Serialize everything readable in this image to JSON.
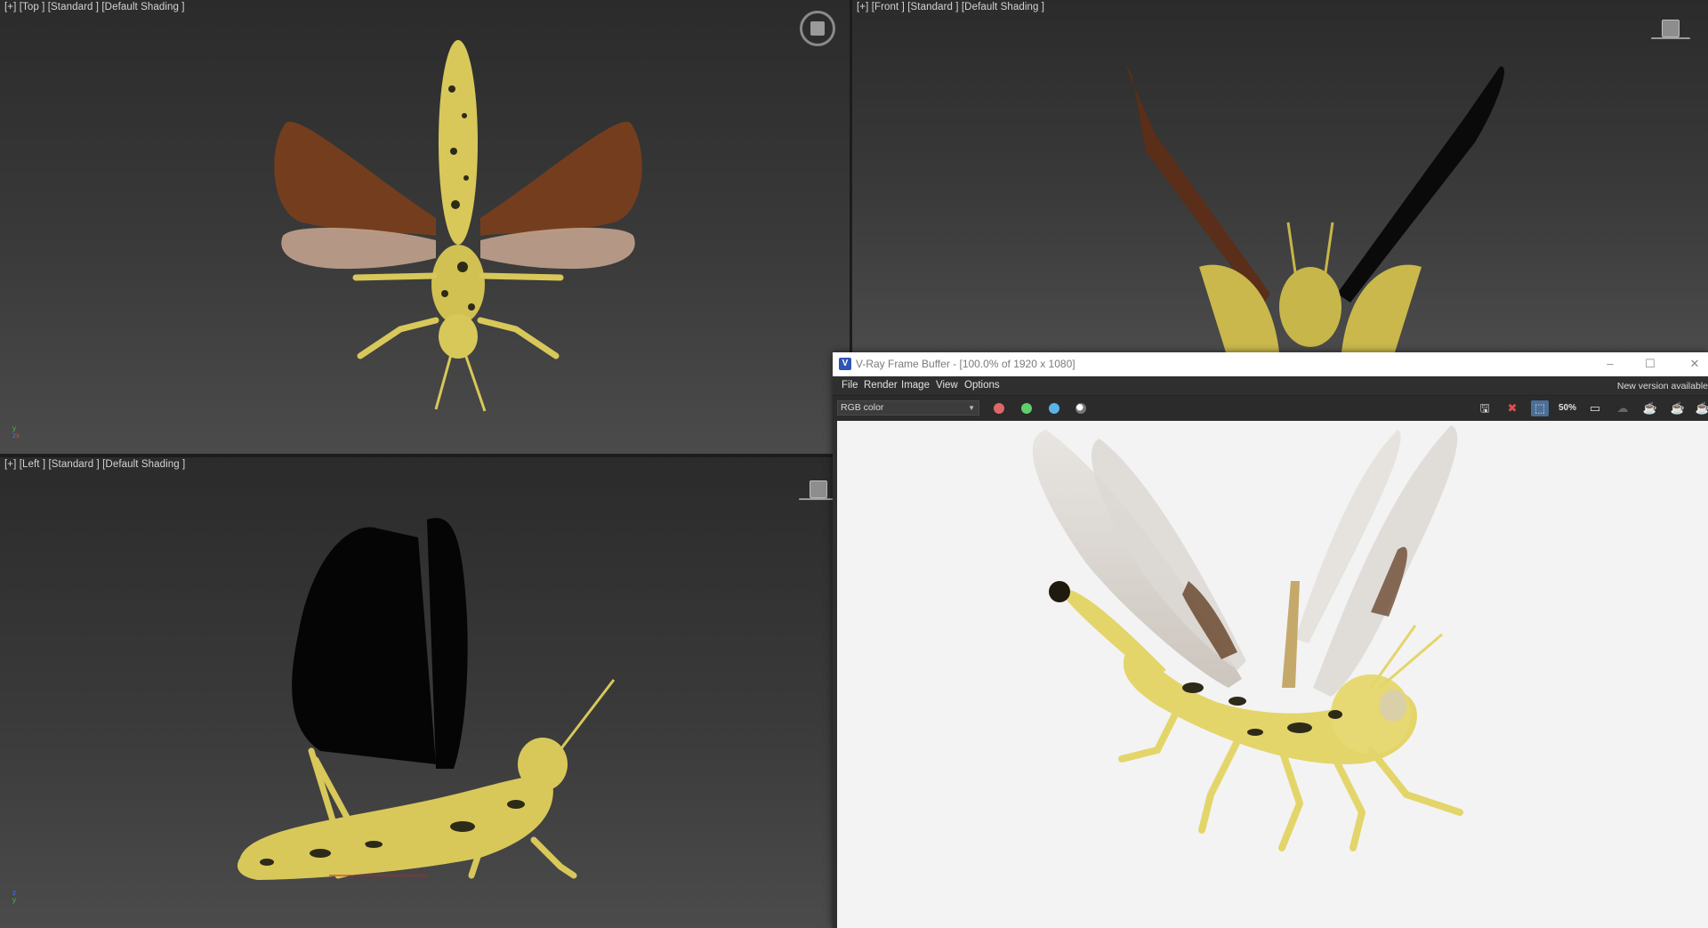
{
  "viewports": {
    "top": {
      "label": "[+] [Top ] [Standard ] [Default Shading ]"
    },
    "front": {
      "label": "[+] [Front ] [Standard ] [Default Shading ]"
    },
    "left": {
      "label": "[+] [Left ] [Standard ] [Default Shading ]"
    }
  },
  "axis_letters": {
    "x": "x",
    "y": "y",
    "z": "z"
  },
  "vfb": {
    "title": "V-Ray Frame Buffer - [100.0% of 1920 x 1080]",
    "logo": "V",
    "window_buttons": {
      "minimize": "–",
      "maximize": "☐",
      "close": "✕"
    },
    "menu": [
      "File",
      "Render",
      "Image",
      "View",
      "Options"
    ],
    "new_version": "New version available",
    "channel": "RGB color",
    "channel_colors": [
      "#e06767",
      "#5fcf6a",
      "#58b6e6"
    ],
    "zoom_label": "50%",
    "toolbar_icons": [
      "save-icon",
      "clear-icon",
      "region-select-icon",
      "zoom-icon",
      "frame-icon",
      "render-interactive-icon",
      "render-teapot-icon",
      "render-teapot-alt-icon",
      "render-teapot-last-icon"
    ]
  },
  "colors": {
    "body_yellow": "#d8c85a",
    "wing_brown": "#7a3f1c",
    "wing_dark": "#0a0a0a",
    "accent_blue": "#4b6f97"
  }
}
